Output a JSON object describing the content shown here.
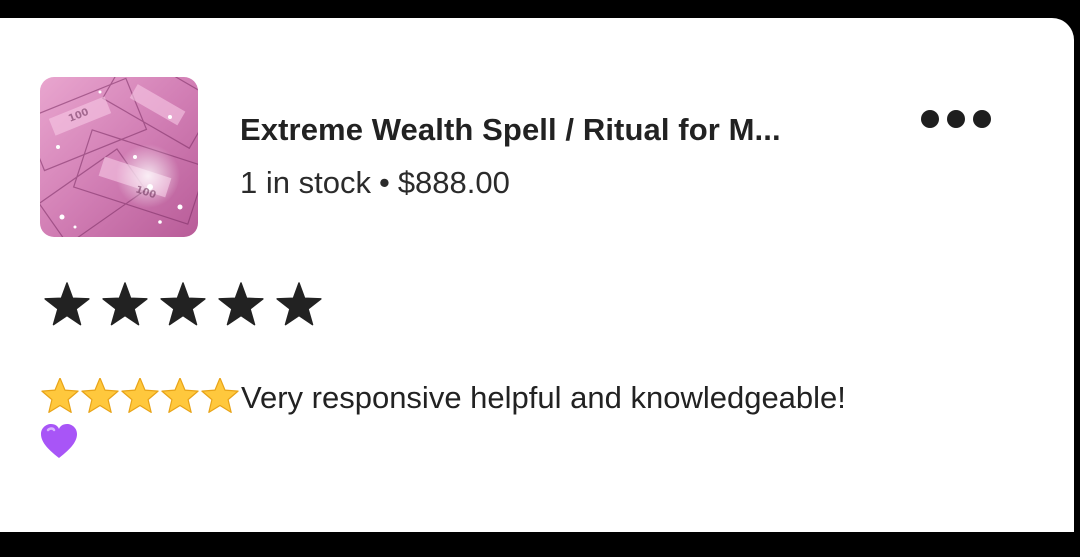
{
  "listing": {
    "title": "Extreme Wealth Spell / Ritual for M...",
    "stock": "1 in stock",
    "separator": "•",
    "price": "$888.00",
    "thumbnail_icon": "pink-money-glitter-image"
  },
  "menu": {
    "icon": "more-options-icon"
  },
  "rating": {
    "stars": 5,
    "max": 5,
    "color": "#222222"
  },
  "review": {
    "emoji_prefix": "⭐⭐⭐⭐⭐",
    "text": "Very responsive helpful  and knowledgeable!",
    "emoji_suffix": "💜"
  },
  "colors": {
    "background": "#000000",
    "card": "#ffffff",
    "text": "#222222",
    "emoji_star": "#FFC83D",
    "emoji_heart": "#A855F7"
  }
}
